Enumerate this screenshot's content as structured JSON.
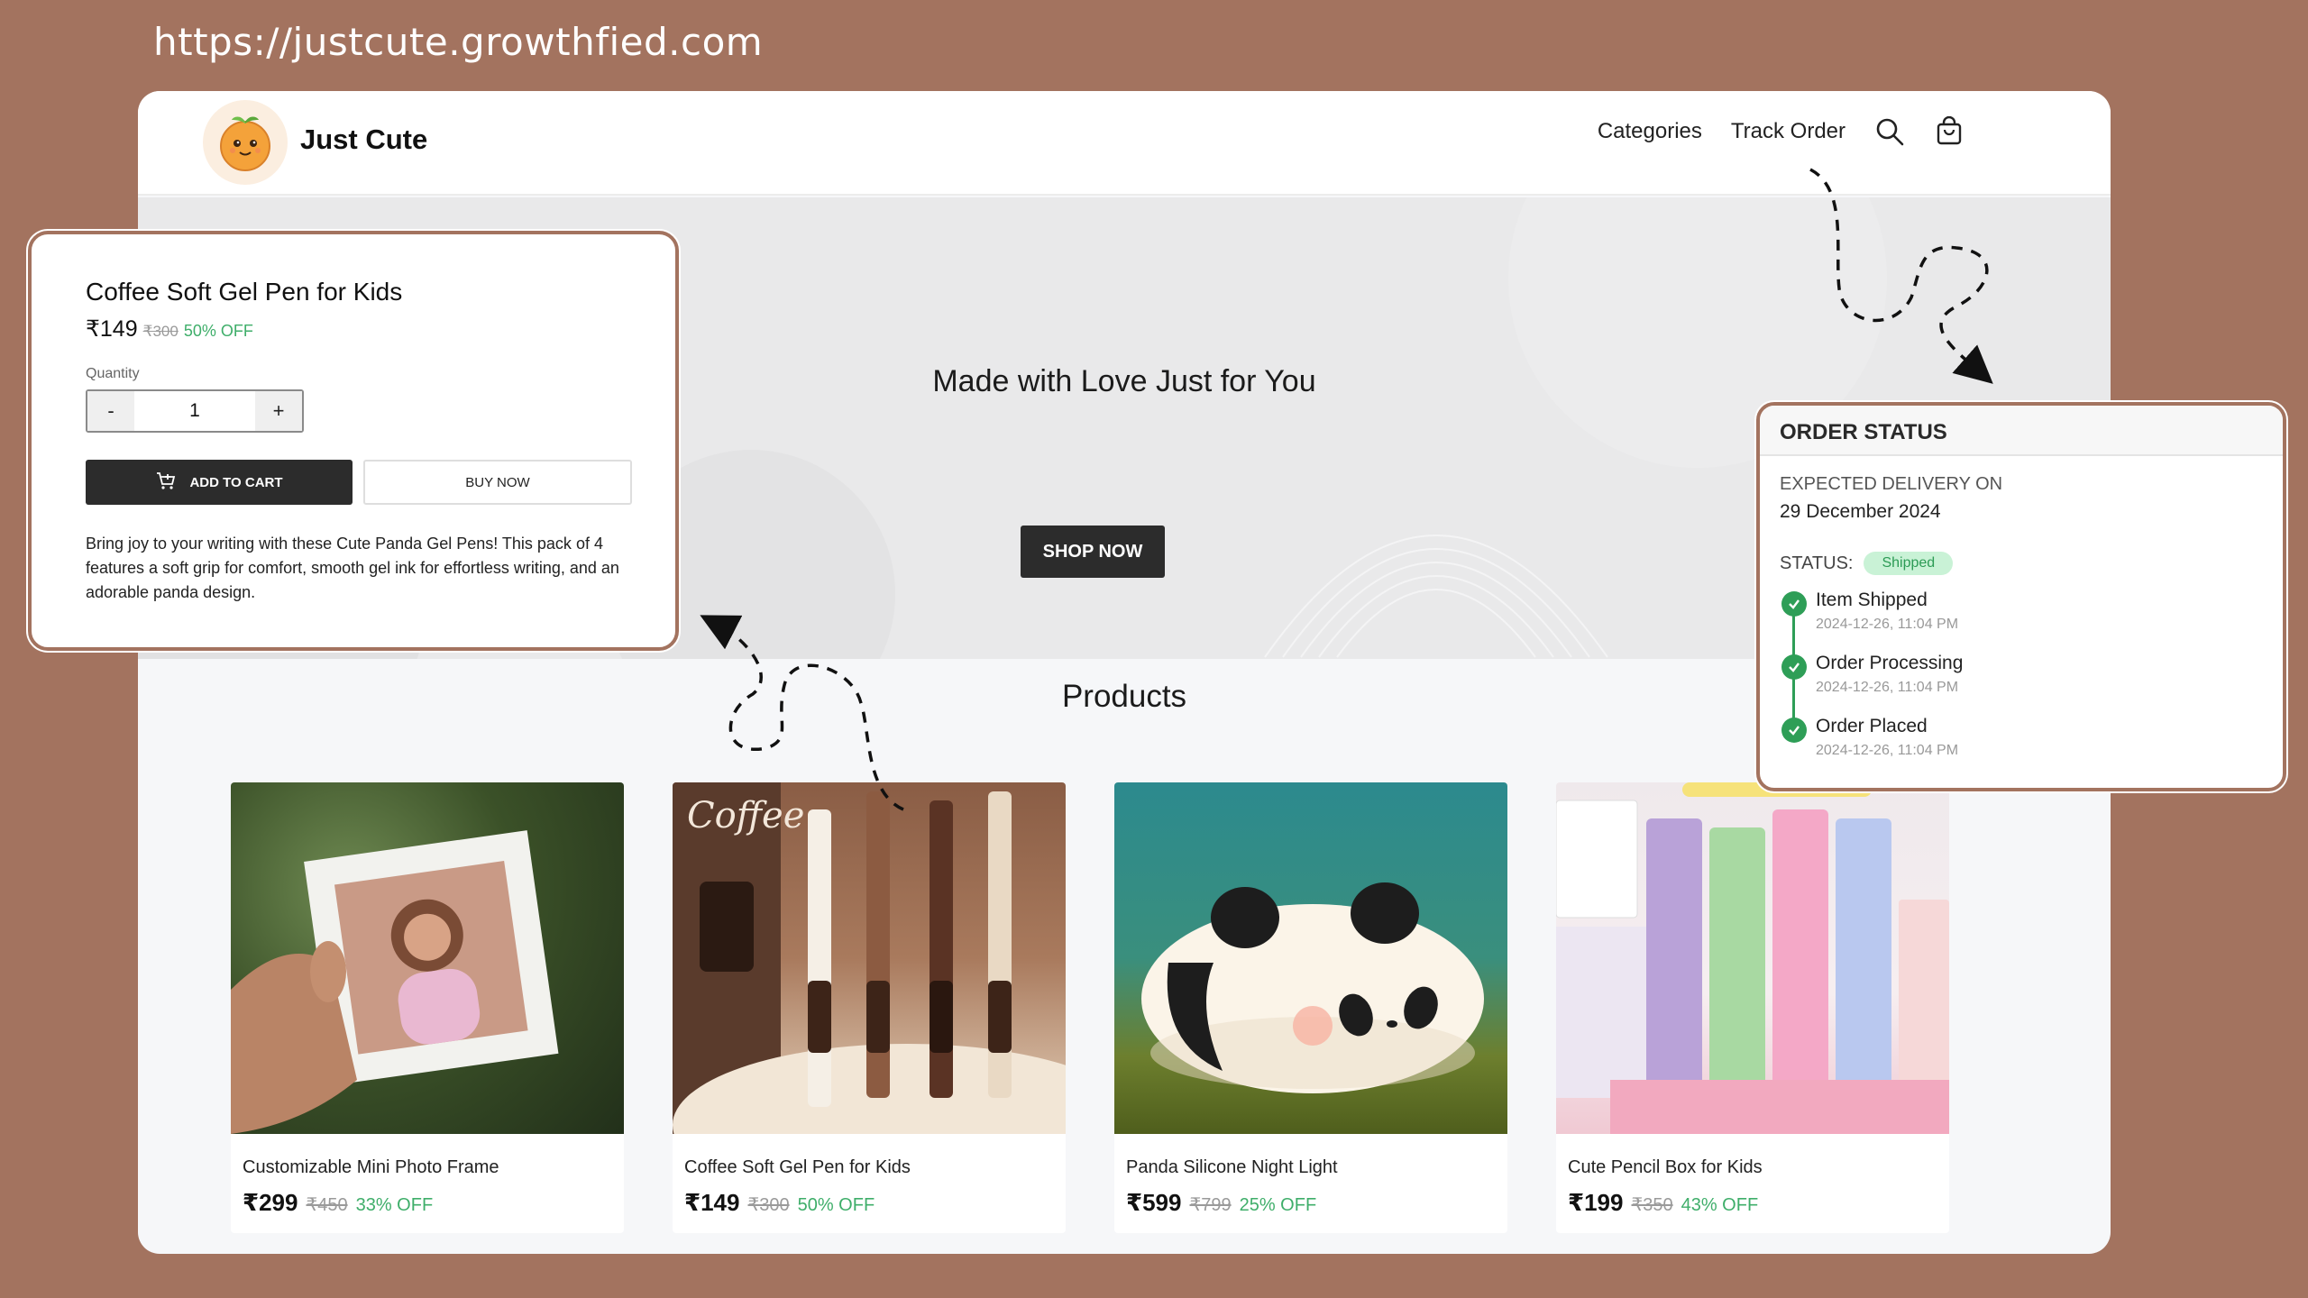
{
  "url": "https://justcute.growthfied.com",
  "header": {
    "brand": "Just Cute",
    "nav": {
      "categories": "Categories",
      "track_order": "Track Order"
    }
  },
  "hero": {
    "title": "Made with Love Just for You",
    "button": "SHOP NOW"
  },
  "products": {
    "title": "Products",
    "items": [
      {
        "name": "Customizable Mini Photo Frame",
        "price": "₹299",
        "old_price": "₹450",
        "discount": "33% OFF"
      },
      {
        "name": "Coffee Soft Gel Pen for Kids",
        "price": "₹149",
        "old_price": "₹300",
        "discount": "50% OFF"
      },
      {
        "name": "Panda Silicone Night Light",
        "price": "₹599",
        "old_price": "₹799",
        "discount": "25% OFF"
      },
      {
        "name": "Cute Pencil Box for Kids",
        "price": "₹199",
        "old_price": "₹350",
        "discount": "43% OFF"
      }
    ]
  },
  "product_detail": {
    "title": "Coffee Soft Gel Pen for Kids",
    "price": "₹149",
    "old_price": "₹300",
    "discount": "50% OFF",
    "quantity_label": "Quantity",
    "quantity": "1",
    "minus": "-",
    "plus": "+",
    "add_to_cart": "ADD TO CART",
    "buy_now": "BUY NOW",
    "description": "Bring joy to your writing with these Cute Panda Gel Pens! This pack of 4 features a soft grip for comfort, smooth gel ink for effortless writing, and an adorable panda design."
  },
  "order_status": {
    "title": "ORDER STATUS",
    "expected_label": "EXPECTED DELIVERY ON",
    "expected_date": "29 December 2024",
    "status_label": "STATUS:",
    "status_value": "Shipped",
    "timeline": [
      {
        "title": "Item Shipped",
        "time": "2024-12-26, 11:04 PM"
      },
      {
        "title": "Order Processing",
        "time": "2024-12-26, 11:04 PM"
      },
      {
        "title": "Order Placed",
        "time": "2024-12-26, 11:04 PM"
      }
    ]
  },
  "colors": {
    "background": "#a3735f",
    "accent_dark": "#2c2c2c",
    "discount_green": "#3fae6a",
    "status_green": "#2e9e57"
  },
  "icons": [
    "logo-orange-icon",
    "search-icon",
    "cart-icon",
    "add-cart-icon",
    "check-icon",
    "dashed-arrow-icon"
  ]
}
